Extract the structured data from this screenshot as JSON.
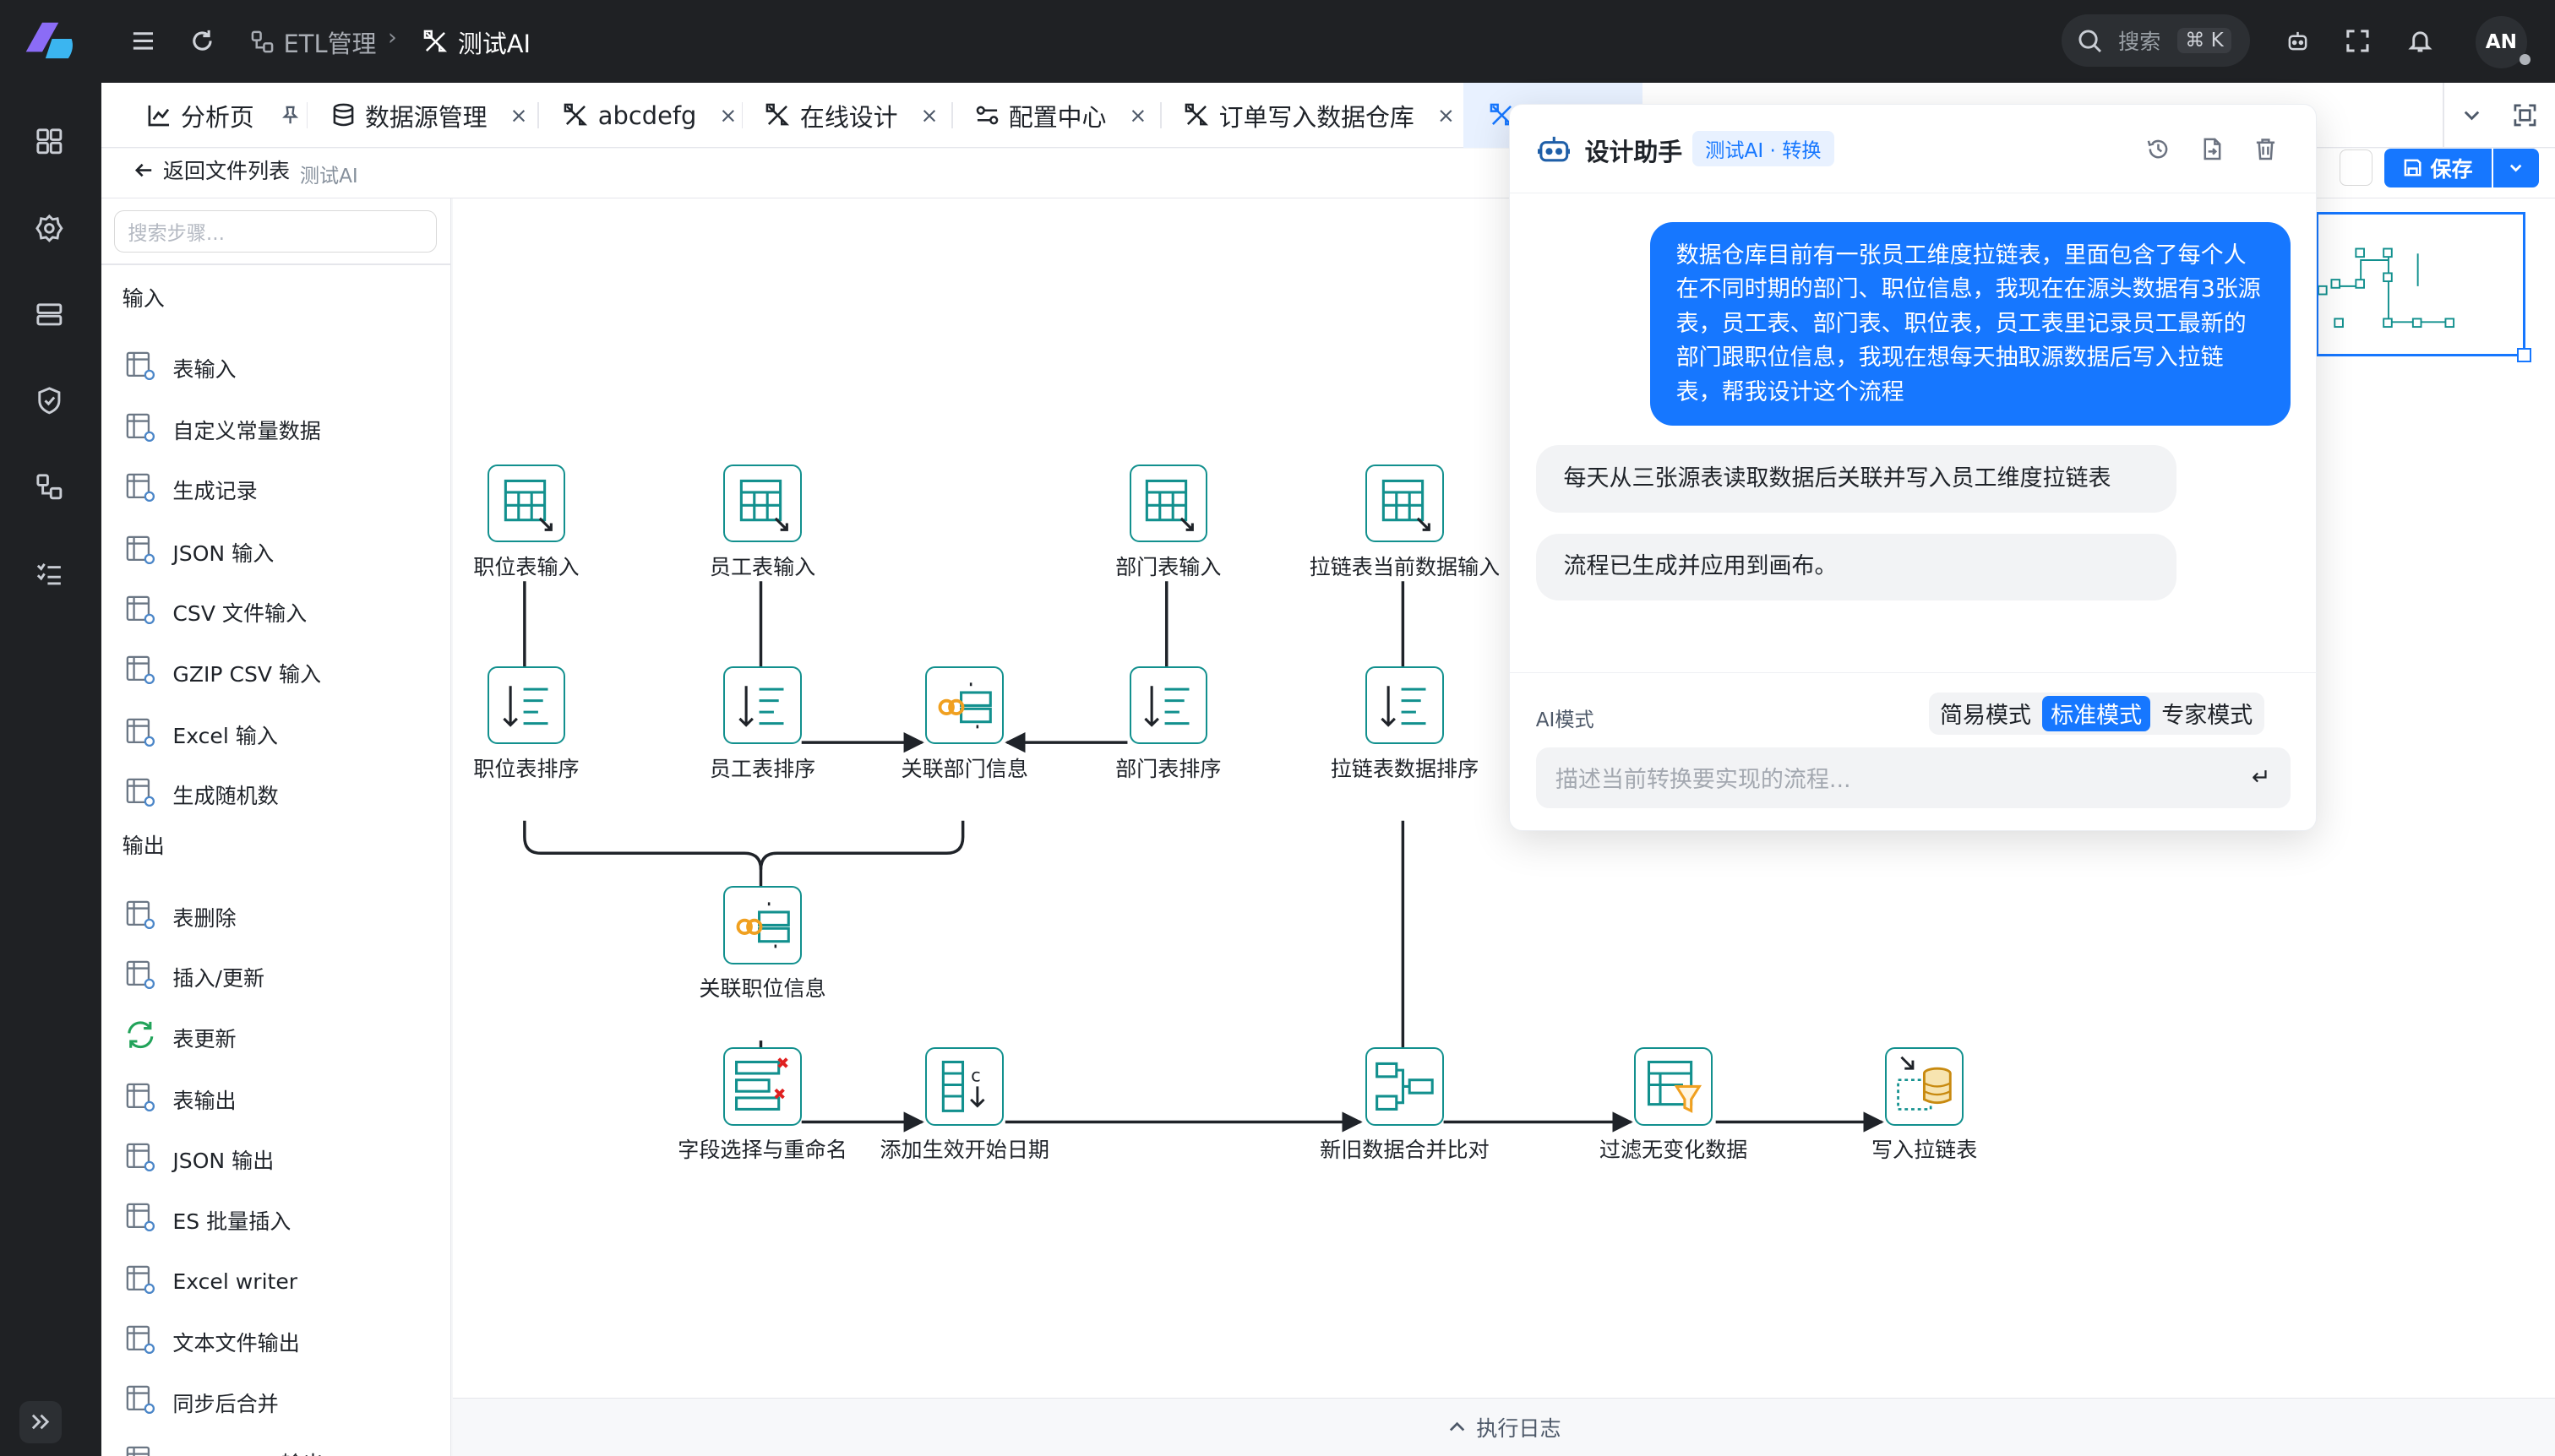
{
  "topbar": {
    "breadcrumb_parent": "ETL管理",
    "breadcrumb_sep": "›",
    "breadcrumb_current": "测试AI",
    "search_label": "搜索",
    "search_shortcut": "⌘ K",
    "avatar": "AN"
  },
  "tabs": [
    {
      "label": "分析页",
      "icon": "chart-icon",
      "pinned": true
    },
    {
      "label": "数据源管理",
      "icon": "database-icon"
    },
    {
      "label": "abcdefg",
      "icon": "design-icon"
    },
    {
      "label": "在线设计",
      "icon": "design-icon"
    },
    {
      "label": "配置中心",
      "icon": "config-icon"
    },
    {
      "label": "订单写入数据仓库",
      "icon": "design-icon"
    }
  ],
  "tab_close": "×",
  "subheader": {
    "back_label": "返回文件列表",
    "file_name": "测试AI",
    "save_label": "保存"
  },
  "palette": {
    "search_placeholder": "搜索步骤...",
    "groups": [
      {
        "title": "输入",
        "items": [
          "表输入",
          "自定义常量数据",
          "生成记录",
          "JSON 输入",
          "CSV 文件输入",
          "GZIP CSV 输入",
          "Excel 输入",
          "生成随机数"
        ]
      },
      {
        "title": "输出",
        "items": [
          "表删除",
          "插入/更新",
          "表更新",
          "表输出",
          "JSON 输出",
          "ES 批量插入",
          "Excel writer",
          "文本文件输出",
          "同步后合并",
          "MongoDB 输出"
        ]
      }
    ]
  },
  "flow": {
    "nodes": [
      {
        "label": "职位表输入",
        "icon": "table-input-icon"
      },
      {
        "label": "员工表输入",
        "icon": "table-input-icon"
      },
      {
        "label": "部门表输入",
        "icon": "table-input-icon"
      },
      {
        "label": "拉链表当前数据输入",
        "icon": "table-input-icon"
      },
      {
        "label": "职位表排序",
        "icon": "sort-icon"
      },
      {
        "label": "员工表排序",
        "icon": "sort-icon"
      },
      {
        "label": "关联部门信息",
        "icon": "join-icon"
      },
      {
        "label": "部门表排序",
        "icon": "sort-icon"
      },
      {
        "label": "拉链表数据排序",
        "icon": "sort-icon"
      },
      {
        "label": "关联职位信息",
        "icon": "join-icon"
      },
      {
        "label": "字段选择与重命名",
        "icon": "select-fields-icon"
      },
      {
        "label": "添加生效开始日期",
        "icon": "add-constant-icon"
      },
      {
        "label": "新旧数据合并比对",
        "icon": "merge-compare-icon"
      },
      {
        "label": "过滤无变化数据",
        "icon": "filter-icon"
      },
      {
        "label": "写入拉链表",
        "icon": "table-output-icon"
      }
    ]
  },
  "log_bar": "执行日志",
  "assistant": {
    "title": "设计助手",
    "badge": "测试AI · 转换",
    "user_message": "数据仓库目前有一张员工维度拉链表，里面包含了每个人在不同时期的部门、职位信息，我现在在源头数据有3张源表，员工表、部门表、职位表，员工表里记录员工最新的部门跟职位信息，我现在想每天抽取源数据后写入拉链表，帮我设计这个流程",
    "bot_messages": [
      "每天从三张源表读取数据后关联并写入员工维度拉链表",
      "流程已生成并应用到画布。"
    ],
    "mode_label": "AI模式",
    "modes": [
      "简易模式",
      "标准模式",
      "专家模式"
    ],
    "active_mode": "标准模式",
    "input_placeholder": "描述当前转换要实现的流程...",
    "enter_glyph": "↵"
  },
  "colors": {
    "accent": "#1677ff",
    "node_border": "#12908e",
    "rail": "#1f2124"
  }
}
